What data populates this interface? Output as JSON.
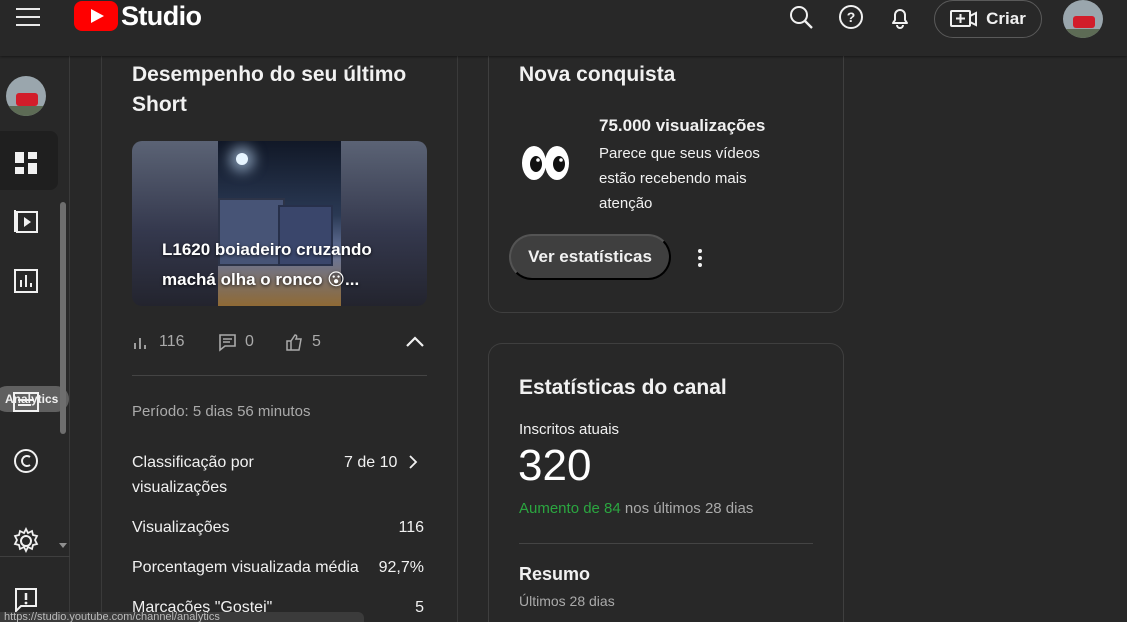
{
  "app": {
    "brand": "Studio",
    "create_button": "Criar"
  },
  "sidebar": {
    "tooltip": "Analytics"
  },
  "latest_short": {
    "title_line1": "Desempenho do seu último",
    "title_line2": "Short",
    "video_title": "L1620 boiadeiro cruzando machá olha o ronco 😮...",
    "views": "116",
    "comments": "0",
    "likes": "5",
    "period": "Período: 5 dias 56 minutos",
    "metrics": [
      {
        "label": "Classificação por visualizações",
        "value": "7 de 10"
      },
      {
        "label": "Visualizações",
        "value": "116"
      },
      {
        "label": "Porcentagem visualizada média",
        "value": "92,7%"
      },
      {
        "label": "Marcações \"Gostei\"",
        "value": "5"
      }
    ]
  },
  "achievement": {
    "title": "Nova conquista",
    "headline": "75.000 visualizações",
    "description": "Parece que seus vídeos estão recebendo mais atenção",
    "button": "Ver estatísticas"
  },
  "channel_stats": {
    "title": "Estatísticas do canal",
    "subscribers_label": "Inscritos atuais",
    "subscribers": "320",
    "growth_highlight": "Aumento de 84",
    "growth_suffix": " nos últimos 28 dias",
    "summary_title": "Resumo",
    "summary_subtitle": "Últimos 28 dias"
  },
  "status": {
    "url": "https://studio.youtube.com/channel/analytics"
  },
  "colors": {
    "accent_red": "#ff0000",
    "positive_green": "#2ba640",
    "surface": "#282828"
  },
  "icons": {
    "menu": "hamburger-menu-icon",
    "search": "search-icon",
    "help": "help-icon",
    "notifications": "bell-icon",
    "create": "video-add-icon",
    "dashboard": "dashboard-icon",
    "content": "content-icon",
    "analytics": "analytics-icon",
    "subtitles": "subtitles-icon",
    "copyright": "copyright-icon",
    "settings": "gear-icon",
    "feedback": "feedback-icon",
    "views": "bar-chart-icon",
    "comments": "comment-icon",
    "likes": "thumbs-up-icon",
    "collapse": "chevron-up-icon",
    "detail": "chevron-right-icon",
    "more": "kebab-menu-icon",
    "achievement": "eyes-icon"
  }
}
